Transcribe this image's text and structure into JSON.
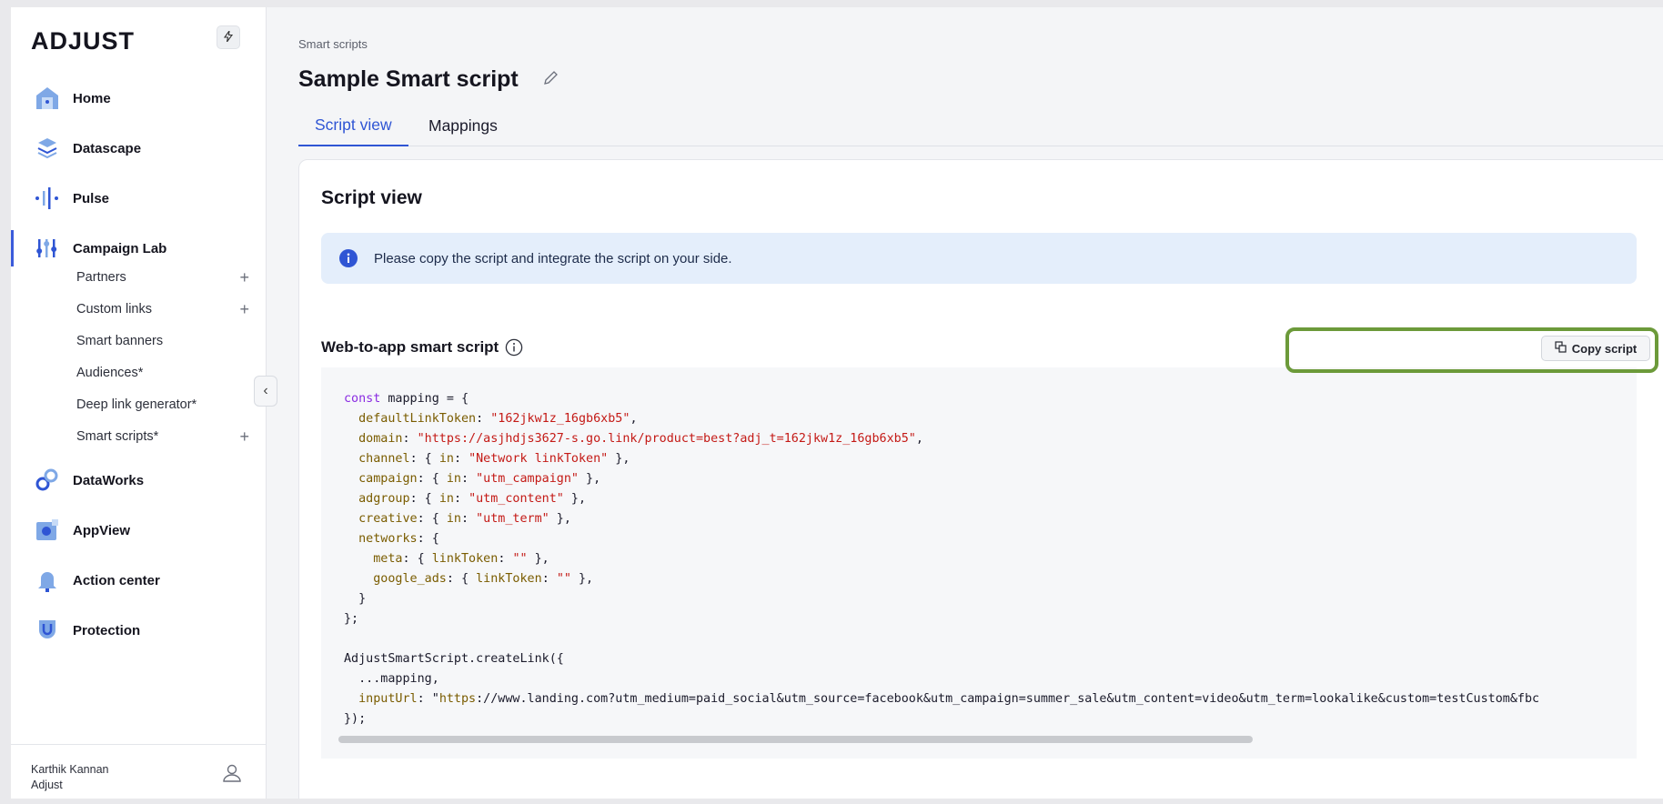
{
  "sidebar": {
    "logo": "ADJUST",
    "nav": [
      {
        "label": "Home"
      },
      {
        "label": "Datascape"
      },
      {
        "label": "Pulse"
      },
      {
        "label": "Campaign Lab"
      },
      {
        "label": "DataWorks"
      },
      {
        "label": "AppView"
      },
      {
        "label": "Action center"
      },
      {
        "label": "Protection"
      }
    ],
    "sub_items": [
      {
        "label": "Partners",
        "plus": "+"
      },
      {
        "label": "Custom links",
        "plus": "+"
      },
      {
        "label": "Smart banners",
        "plus": ""
      },
      {
        "label": "Audiences*",
        "plus": ""
      },
      {
        "label": "Deep link generator*",
        "plus": ""
      },
      {
        "label": "Smart scripts*",
        "plus": "+"
      }
    ],
    "user": {
      "name": "Karthik Kannan",
      "org": "Adjust"
    }
  },
  "header": {
    "breadcrumb": "Smart scripts",
    "title": "Sample Smart script",
    "tabs": [
      {
        "label": "Script view",
        "active": true
      },
      {
        "label": "Mappings",
        "active": false
      }
    ]
  },
  "card": {
    "title": "Script view",
    "banner": "Please copy the script and integrate the script on your side.",
    "section_title": "Web-to-app smart script",
    "copy_label": "Copy script"
  },
  "code_lines": [
    "const mapping = {",
    "  defaultLinkToken: \"162jkw1z_16gb6xb5\",",
    "  domain: \"https://asjhdjs3627-s.go.link/product=best?adj_t=162jkw1z_16gb6xb5\",",
    "  channel: { in: \"Network linkToken\" },",
    "  campaign: { in: \"utm_campaign\" },",
    "  adgroup: { in: \"utm_content\" },",
    "  creative: { in: \"utm_term\" },",
    "  networks: {",
    "    meta: { linkToken: \"\" },",
    "    google_ads: { linkToken: \"\" },",
    "  }",
    "};",
    "",
    "AdjustSmartScript.createLink({",
    "  ...mapping,",
    "  inputUrl: \"https://www.landing.com?utm_medium=paid_social&utm_source=facebook&utm_campaign=summer_sale&utm_content=video&utm_term=lookalike&custom=testCustom&fbc",
    "});"
  ],
  "colors": {
    "accent": "#2f55d4",
    "highlight": "#6c9a3a",
    "banner": "#e4eefb"
  }
}
